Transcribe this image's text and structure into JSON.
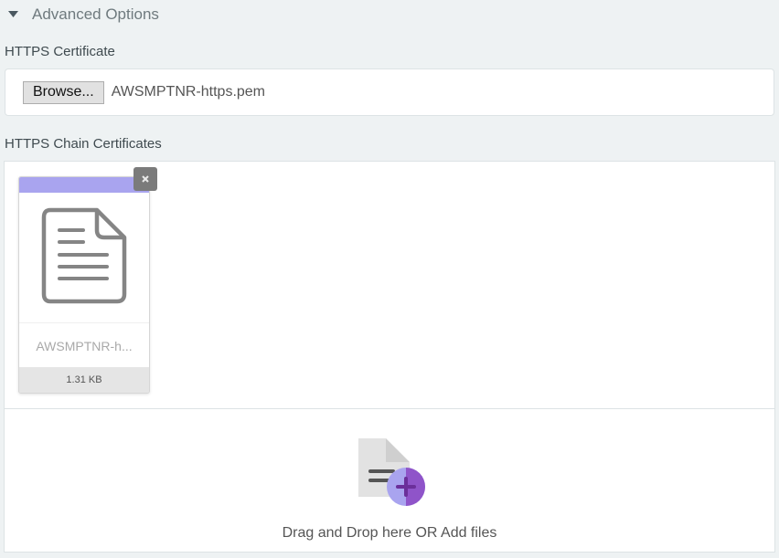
{
  "advanced": {
    "title": "Advanced Options",
    "icon": "caret-down-icon"
  },
  "https_certificate": {
    "label": "HTTPS Certificate",
    "browse_label": "Browse...",
    "file_name": "AWSMPTNR-https.pem"
  },
  "chain_certificates": {
    "label": "HTTPS Chain Certificates",
    "files": [
      {
        "name": "AWSMPTNR-h...",
        "size": "1.31 KB",
        "icon": "document-icon",
        "remove_icon": "close-icon"
      }
    ],
    "dropzone": {
      "text": "Drag and Drop here OR Add files",
      "icon": "add-file-icon"
    }
  },
  "colors": {
    "accent": "#a9a4ef",
    "accent_dark": "#8f54c9",
    "background": "#eef2f3"
  }
}
